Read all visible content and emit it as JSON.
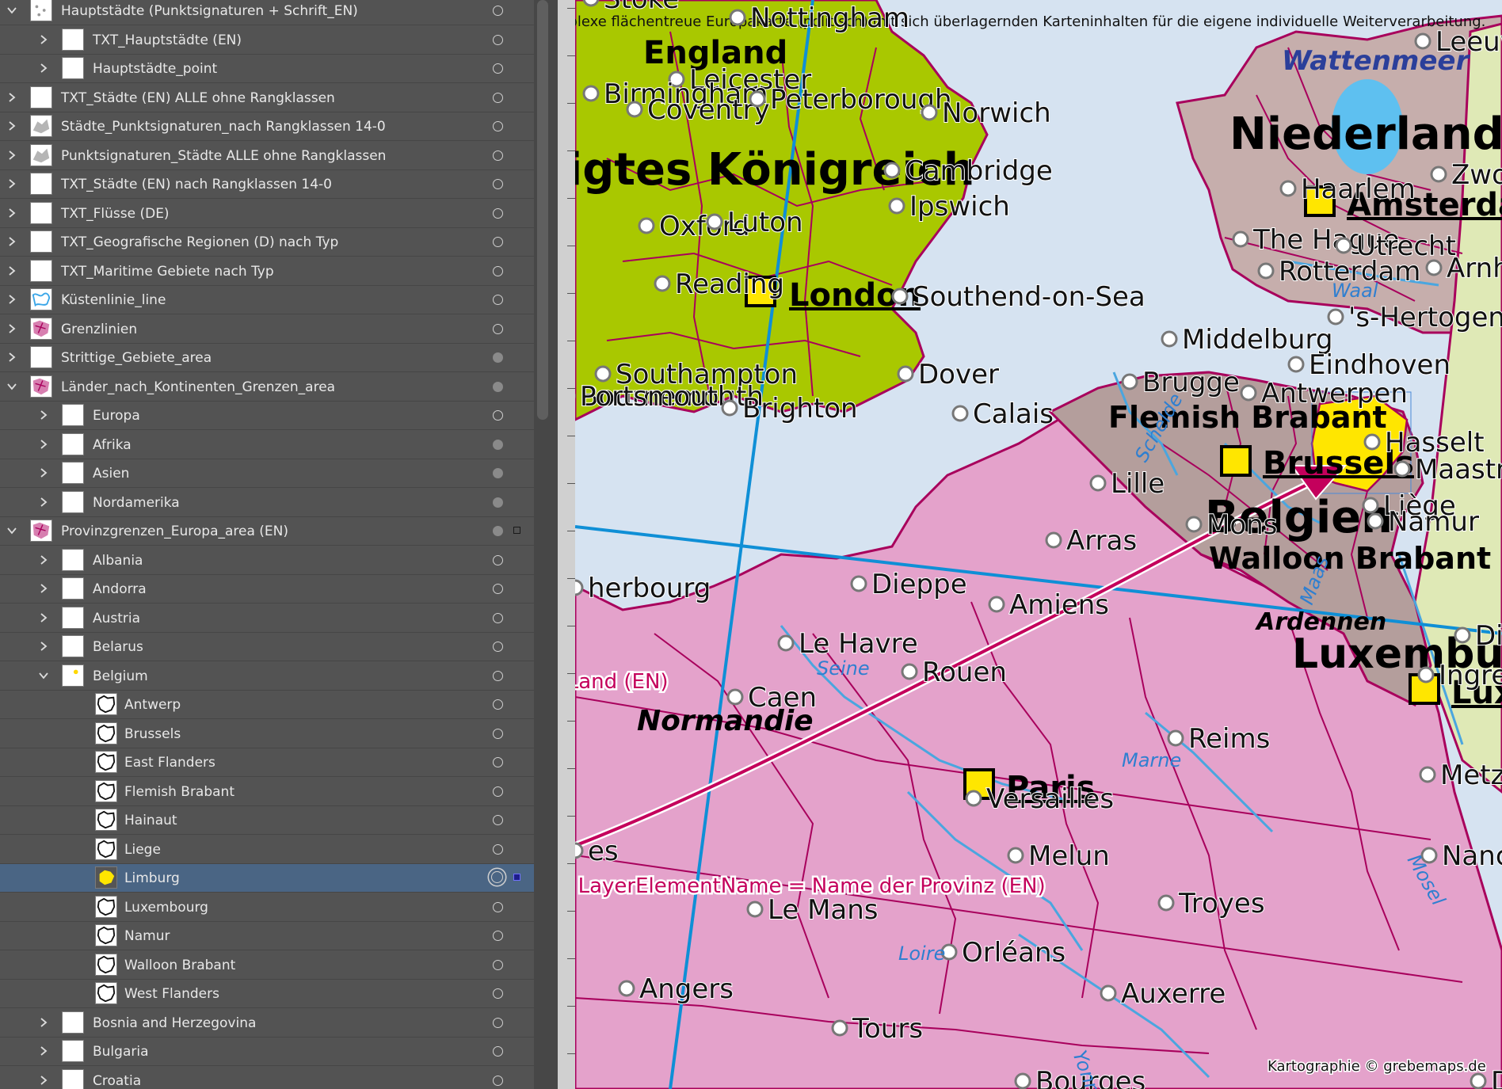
{
  "layers": [
    {
      "label": "Hauptstädte (Punktsignaturen + Schrift_EN)",
      "indent": 0,
      "expanded": true,
      "thumb": "points",
      "vis": "open"
    },
    {
      "label": "TXT_Hauptstädte (EN)",
      "indent": 1,
      "expanded": false,
      "thumb": "blank",
      "vis": "open"
    },
    {
      "label": "Hauptstädte_point",
      "indent": 1,
      "expanded": false,
      "thumb": "blank",
      "vis": "open"
    },
    {
      "label": "TXT_Städte (EN) ALLE ohne Rangklassen",
      "indent": 0,
      "expanded": false,
      "thumb": "blank",
      "vis": "open"
    },
    {
      "label": "Städte_Punktsignaturen_nach Rangklassen 14-0",
      "indent": 0,
      "expanded": false,
      "thumb": "gray",
      "vis": "open"
    },
    {
      "label": "Punktsignaturen_Städte ALLE ohne Rangklassen",
      "indent": 0,
      "expanded": false,
      "thumb": "gray",
      "vis": "open"
    },
    {
      "label": "TXT_Städte (EN) nach Rangklassen 14-0",
      "indent": 0,
      "expanded": false,
      "thumb": "blank",
      "vis": "open"
    },
    {
      "label": "TXT_Flüsse (DE)",
      "indent": 0,
      "expanded": false,
      "thumb": "blank",
      "vis": "open"
    },
    {
      "label": "TXT_Geografische Regionen (D) nach Typ",
      "indent": 0,
      "expanded": false,
      "thumb": "blank",
      "vis": "open"
    },
    {
      "label": "TXT_Maritime Gebiete nach Typ",
      "indent": 0,
      "expanded": false,
      "thumb": "blank",
      "vis": "open"
    },
    {
      "label": "Küstenlinie_line",
      "indent": 0,
      "expanded": false,
      "thumb": "blue",
      "vis": "open"
    },
    {
      "label": "Grenzlinien",
      "indent": 0,
      "expanded": false,
      "thumb": "pink",
      "vis": "open"
    },
    {
      "label": "Strittige_Gebiete_area",
      "indent": 0,
      "expanded": false,
      "thumb": "blank",
      "vis": "filled"
    },
    {
      "label": "Länder_nach_Kontinenten_Grenzen_area",
      "indent": 0,
      "expanded": true,
      "thumb": "pink",
      "vis": "filled"
    },
    {
      "label": "Europa",
      "indent": 1,
      "expanded": false,
      "thumb": "blank",
      "vis": "open"
    },
    {
      "label": "Afrika",
      "indent": 1,
      "expanded": false,
      "thumb": "blank",
      "vis": "filled"
    },
    {
      "label": "Asien",
      "indent": 1,
      "expanded": false,
      "thumb": "blank",
      "vis": "filled"
    },
    {
      "label": "Nordamerika",
      "indent": 1,
      "expanded": false,
      "thumb": "blank",
      "vis": "filled"
    },
    {
      "label": "Provinzgrenzen_Europa_area (EN)",
      "indent": 0,
      "expanded": true,
      "thumb": "pink",
      "vis": "filled",
      "selbox": "open"
    },
    {
      "label": "Albania",
      "indent": 1,
      "expanded": false,
      "thumb": "blank",
      "vis": "open"
    },
    {
      "label": "Andorra",
      "indent": 1,
      "expanded": false,
      "thumb": "blank",
      "vis": "open"
    },
    {
      "label": "Austria",
      "indent": 1,
      "expanded": false,
      "thumb": "blank",
      "vis": "open"
    },
    {
      "label": "Belarus",
      "indent": 1,
      "expanded": false,
      "thumb": "blank",
      "vis": "open"
    },
    {
      "label": "Belgium",
      "indent": 1,
      "expanded": true,
      "thumb": "dot",
      "vis": "open"
    },
    {
      "label": "Antwerp",
      "indent": 2,
      "thumb": "shape",
      "vis": "open"
    },
    {
      "label": "Brussels",
      "indent": 2,
      "thumb": "shape",
      "vis": "open"
    },
    {
      "label": "East Flanders",
      "indent": 2,
      "thumb": "shape",
      "vis": "open"
    },
    {
      "label": "Flemish Brabant",
      "indent": 2,
      "thumb": "shape",
      "vis": "open"
    },
    {
      "label": "Hainaut",
      "indent": 2,
      "thumb": "shape",
      "vis": "open"
    },
    {
      "label": "Liege",
      "indent": 2,
      "thumb": "shape",
      "vis": "open"
    },
    {
      "label": "Limburg",
      "indent": 2,
      "thumb": "yellow",
      "vis": "target",
      "selbox": "filled",
      "selected": true
    },
    {
      "label": "Luxembourg",
      "indent": 2,
      "thumb": "shape",
      "vis": "open"
    },
    {
      "label": "Namur",
      "indent": 2,
      "thumb": "shape",
      "vis": "open"
    },
    {
      "label": "Walloon Brabant",
      "indent": 2,
      "thumb": "shape",
      "vis": "open"
    },
    {
      "label": "West Flanders",
      "indent": 2,
      "thumb": "shape",
      "vis": "open"
    },
    {
      "label": "Bosnia and Herzegovina",
      "indent": 1,
      "expanded": false,
      "thumb": "blank",
      "vis": "open"
    },
    {
      "label": "Bulgaria",
      "indent": 1,
      "expanded": false,
      "thumb": "blank",
      "vis": "open"
    },
    {
      "label": "Croatia",
      "indent": 1,
      "expanded": false,
      "thumb": "blank",
      "vis": "open"
    }
  ],
  "map": {
    "header": "Komplexe flächentreue Europakarte (politisch) mit sich überlagernden Karteninhalten für die eigene individuelle Weiterverarbeitung.",
    "copyright": "Kartographie © grebemaps.de",
    "annotation_1": "<<< Provinzen gruppiert JE Land (EN)",
    "annotation_2": "<<< LayerElementName = Name der Provinz (EN)",
    "colors": {
      "sea": "#d6e3f1",
      "uk": "#a9c800",
      "france": "#e4a2cb",
      "belgium": "#b49e9c",
      "netherlands": "#c6aeac",
      "germany": "#dfe9b6",
      "border": "#a8005c",
      "river": "#4aa6df",
      "grid": "#0f8fd6",
      "annotation": "#c4005c"
    },
    "countries": [
      "igtes Königreich",
      "Niederlande",
      "Belgien",
      "Luxembu"
    ],
    "regions": [
      "England",
      "Normandie",
      "Flemish Brabant",
      "Walloon Brabant",
      "Ardennen",
      "Wattenmeer"
    ],
    "capitals": [
      "London",
      "Amsterdam",
      "Brussels",
      "Paris",
      "Lux"
    ],
    "cities": [
      "Stoke",
      "Nottingham",
      "Leicester",
      "Birmingham",
      "Coventry",
      "Peterborough",
      "Norwich",
      "Cambridge",
      "Ipswich",
      "Oxford",
      "Luton",
      "Reading",
      "Southend-on-Sea",
      "Southampton",
      "Bournemouth",
      "Portsmouth",
      "Brighton",
      "Dover",
      "Calais",
      "Brugge",
      "Antwerpen",
      "Middelburg",
      "Eindhoven",
      "'s-Hertogen",
      "Haarlem",
      "Zwo",
      "The Hague",
      "Utrecht",
      "Rotterdam",
      "Arnhe",
      "Leeuw",
      "Lille",
      "Arras",
      "Hasselt",
      "Maastrich",
      "Liège",
      "Namur",
      "Mons",
      "Dieppe",
      "Amiens",
      "Le Havre",
      "Rouen",
      "Caen",
      "herbourg",
      "Reims",
      "Melun",
      "Metz",
      "Nancy",
      "Troyes",
      "Le Mans",
      "Orléans",
      "Auxerre",
      "Angers",
      "Tours",
      "Dijon",
      "es",
      "Bourges",
      "Diek",
      "Ingre",
      "Versailles"
    ],
    "rivers": [
      "Waal",
      "Schelde",
      "Seine",
      "Marne",
      "Maas",
      "Mosel",
      "Loire",
      "Yonne"
    ]
  }
}
